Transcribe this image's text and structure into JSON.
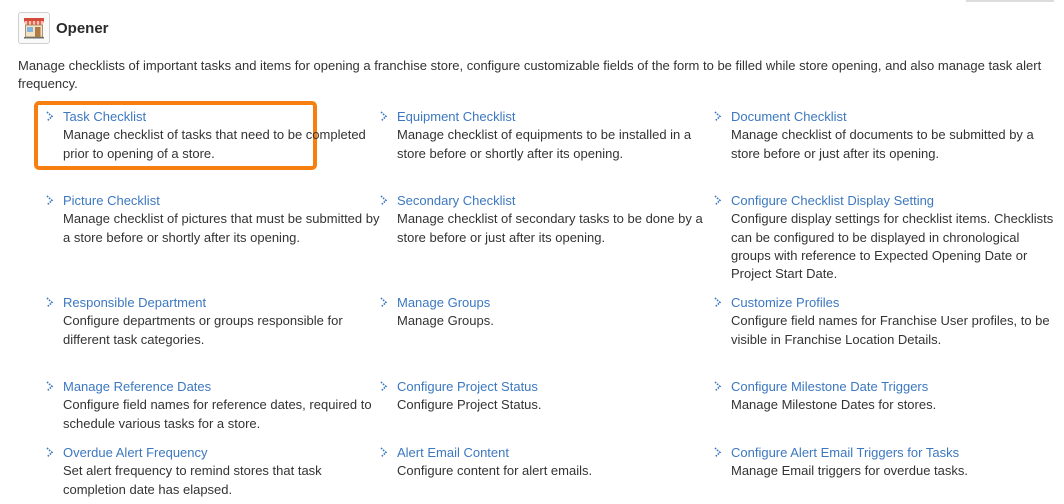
{
  "header": {
    "title": "Opener",
    "icon": "storefront-icon"
  },
  "description": {
    "line1": "Manage checklists of important tasks and items for opening a franchise store, configure customizable fields of the form to be filled while store opening, and also manage task alert",
    "line2": "frequency."
  },
  "colors": {
    "link": "#3c78c0",
    "highlight": "#f77f0f",
    "text": "#333333"
  },
  "items": [
    {
      "title": "Task Checklist",
      "desc": "Manage checklist of tasks that need to be completed prior to opening of a store."
    },
    {
      "title": "Equipment Checklist",
      "desc": "Manage checklist of equipments to be installed in a store before or shortly after its opening."
    },
    {
      "title": "Document Checklist",
      "desc": "Manage checklist of documents to be submitted by a store before or just after its opening."
    },
    {
      "title": "Picture Checklist",
      "desc": "Manage checklist of pictures that must be submitted by a store before or shortly after its opening."
    },
    {
      "title": "Secondary Checklist",
      "desc": "Manage checklist of secondary tasks to be done by a store before or just after its opening."
    },
    {
      "title": "Configure Checklist Display Setting",
      "desc": "Configure display settings for checklist items. Checklists can be configured to be displayed in chronological groups with reference to Expected Opening Date or Project Start Date."
    },
    {
      "title": "Responsible Department",
      "desc": "Configure departments or groups responsible for different task categories."
    },
    {
      "title": "Manage Groups",
      "desc": "Manage Groups."
    },
    {
      "title": "Customize Profiles",
      "desc": "Configure field names for Franchise User profiles, to be visible in Franchise Location Details."
    },
    {
      "title": "Manage Reference Dates",
      "desc": "Configure field names for reference dates, required to schedule various tasks for a store."
    },
    {
      "title": "Configure Project Status",
      "desc": "Configure Project Status."
    },
    {
      "title": "Configure Milestone Date Triggers",
      "desc": "Manage Milestone Dates for stores."
    },
    {
      "title": "Overdue Alert Frequency",
      "desc": "Set alert frequency to remind stores that task completion date has elapsed."
    },
    {
      "title": "Alert Email Content",
      "desc": "Configure content for alert emails."
    },
    {
      "title": "Configure Alert Email Triggers for Tasks",
      "desc": "Manage Email triggers for overdue tasks."
    }
  ]
}
